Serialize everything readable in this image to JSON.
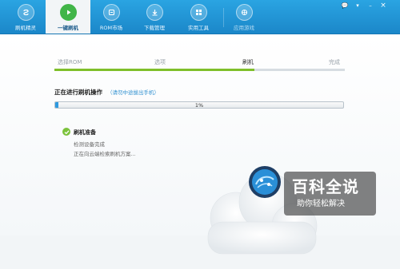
{
  "toolbar": {
    "tabs": [
      {
        "label": "刷机精灵",
        "icon": "flash-sprite-icon"
      },
      {
        "label": "一键刷机",
        "icon": "play-icon"
      },
      {
        "label": "ROM市场",
        "icon": "rom-market-icon"
      },
      {
        "label": "下载管理",
        "icon": "download-icon"
      },
      {
        "label": "实用工具",
        "icon": "tools-icon"
      },
      {
        "label": "应用游戏",
        "icon": "apps-icon"
      }
    ],
    "active_tab": 1,
    "window_buttons": {
      "feedback": "💬",
      "menu": "▾",
      "minimize": "–",
      "close": "×"
    }
  },
  "steps": {
    "items": [
      "选择ROM",
      "选项",
      "刷机",
      "完成"
    ],
    "current": 2,
    "progress_fraction": 0.69
  },
  "operation": {
    "title": "正在进行刷机操作",
    "hint": "（请勿中途拔出手机）",
    "progress_percent": 1,
    "progress_text": "1%"
  },
  "task": {
    "name": "刷机准备",
    "lines": [
      "检测设备完成",
      "正在向云端检索刷机方案..."
    ]
  },
  "watermark": {
    "title": "百科全说",
    "subtitle": "助你轻松解决"
  },
  "colors": {
    "toolbar_top": "#2aa4e2",
    "toolbar_bottom": "#1b87c9",
    "step_green": "#7fbf2a",
    "progress_blue": "#2f9ae0",
    "check_green": "#7bc23b"
  }
}
